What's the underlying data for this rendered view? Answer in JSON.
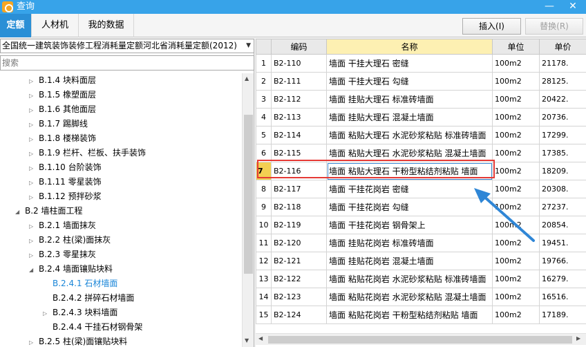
{
  "window": {
    "title": "查询"
  },
  "tabs": [
    {
      "label": "定额",
      "active": true
    },
    {
      "label": "人材机",
      "active": false
    },
    {
      "label": "我的数据",
      "active": false
    }
  ],
  "toolbar": {
    "insert_label": "插入(I)",
    "replace_label": "替换(R)"
  },
  "left_panel": {
    "library_select": "全国统一建筑装饰装修工程消耗量定额河北省消耗量定额(2012)",
    "search_placeholder": "搜索",
    "tree": [
      {
        "label": "B.1.4 块料面层",
        "toggle": "▷",
        "level": 3
      },
      {
        "label": "B.1.5 橡塑面层",
        "toggle": "▷",
        "level": 3
      },
      {
        "label": "B.1.6 其他面层",
        "toggle": "▷",
        "level": 3
      },
      {
        "label": "B.1.7 踢脚线",
        "toggle": "▷",
        "level": 3
      },
      {
        "label": "B.1.8 楼梯装饰",
        "toggle": "▷",
        "level": 3
      },
      {
        "label": "B.1.9 栏杆、栏板、扶手装饰",
        "toggle": "▷",
        "level": 3
      },
      {
        "label": "B.1.10 台阶装饰",
        "toggle": "▷",
        "level": 3
      },
      {
        "label": "B.1.11 零星装饰",
        "toggle": "▷",
        "level": 3
      },
      {
        "label": "B.1.12 预拌砂浆",
        "toggle": "▷",
        "level": 3
      },
      {
        "label": "B.2 墙柱面工程",
        "toggle": "◢",
        "level": 2
      },
      {
        "label": "B.2.1 墙面抹灰",
        "toggle": "▷",
        "level": 3
      },
      {
        "label": "B.2.2 柱(梁)面抹灰",
        "toggle": "▷",
        "level": 3
      },
      {
        "label": "B.2.3 零星抹灰",
        "toggle": "▷",
        "level": 3
      },
      {
        "label": "B.2.4 墙面镶贴块料",
        "toggle": "◢",
        "level": 3
      },
      {
        "label": "B.2.4.1 石材墙面",
        "toggle": "",
        "level": 4,
        "selected": true
      },
      {
        "label": "B.2.4.2 拼碎石材墙面",
        "toggle": "",
        "level": 4
      },
      {
        "label": "B.2.4.3 块料墙面",
        "toggle": "▷",
        "level": 4
      },
      {
        "label": "B.2.4.4 干挂石材钢骨架",
        "toggle": "",
        "level": 4
      },
      {
        "label": "B.2.5 柱(梁)面镶贴块料",
        "toggle": "▷",
        "level": 3
      }
    ]
  },
  "grid": {
    "columns": [
      "",
      "编码",
      "名称",
      "单位",
      "单价"
    ],
    "current_row": 6,
    "rows": [
      [
        "1",
        "B2-110",
        "墙面 干挂大理石 密缝",
        "100m2",
        "21178."
      ],
      [
        "2",
        "B2-111",
        "墙面 干挂大理石 勾缝",
        "100m2",
        "28125."
      ],
      [
        "3",
        "B2-112",
        "墙面 挂贴大理石 标准砖墙面",
        "100m2",
        "20422."
      ],
      [
        "4",
        "B2-113",
        "墙面 挂贴大理石 混凝土墙面",
        "100m2",
        "20736."
      ],
      [
        "5",
        "B2-114",
        "墙面 粘贴大理石 水泥砂浆粘贴 标准砖墙面",
        "100m2",
        "17299."
      ],
      [
        "6",
        "B2-115",
        "墙面 粘贴大理石 水泥砂浆粘贴 混凝土墙面",
        "100m2",
        "17385."
      ],
      [
        "7",
        "B2-116",
        "墙面 粘贴大理石 干粉型粘结剂粘贴 墙面",
        "100m2",
        "18209."
      ],
      [
        "8",
        "B2-117",
        "墙面 干挂花岗岩 密缝",
        "100m2",
        "20308."
      ],
      [
        "9",
        "B2-118",
        "墙面 干挂花岗岩 勾缝",
        "100m2",
        "27237."
      ],
      [
        "10",
        "B2-119",
        "墙面 干挂花岗岩 钢骨架上",
        "100m2",
        "20854."
      ],
      [
        "11",
        "B2-120",
        "墙面 挂贴花岗岩 标准砖墙面",
        "100m2",
        "19451."
      ],
      [
        "12",
        "B2-121",
        "墙面 挂贴花岗岩 混凝土墙面",
        "100m2",
        "19766."
      ],
      [
        "13",
        "B2-122",
        "墙面 粘贴花岗岩 水泥砂浆粘贴 标准砖墙面",
        "100m2",
        "16279."
      ],
      [
        "14",
        "B2-123",
        "墙面 粘贴花岗岩 水泥砂浆粘贴 混凝土墙面",
        "100m2",
        "16516."
      ],
      [
        "15",
        "B2-124",
        "墙面 粘贴花岗岩 干粉型粘结剂粘贴 墙面",
        "100m2",
        "17189."
      ]
    ]
  },
  "icons": {
    "app": "app-logo-icon",
    "minimize": "minimize-icon",
    "close": "close-icon"
  },
  "colors": {
    "titlebar": "#37a3e9",
    "active_tab": "#2a8fd6",
    "highlight_box": "#e53935",
    "annotation_arrow": "#2f86d6",
    "current_row_marker": "#f3cf52",
    "name_header": "#fdf0b2"
  }
}
